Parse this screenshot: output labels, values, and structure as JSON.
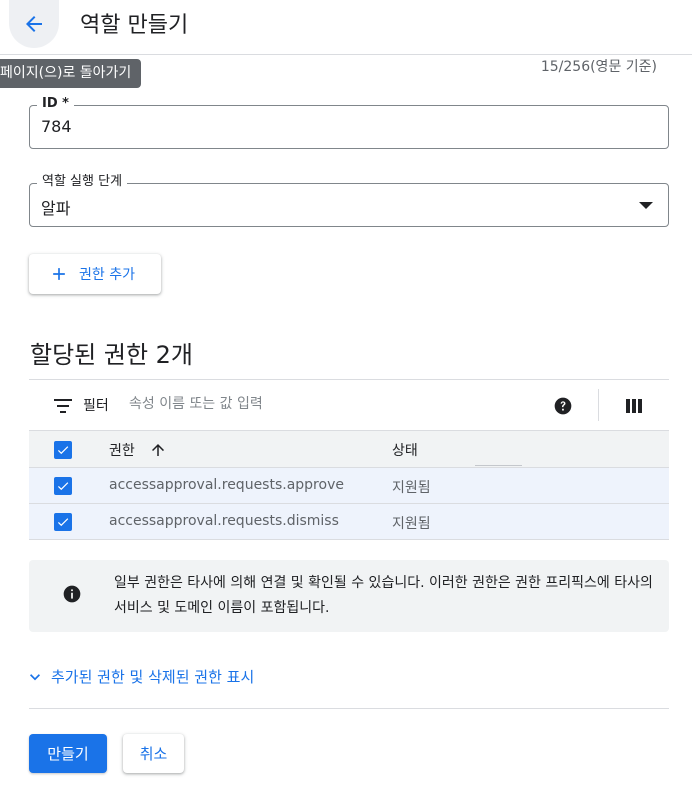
{
  "header": {
    "title": "역할 만들기",
    "back_tooltip": "페이지(으)로 돌아가기"
  },
  "form": {
    "char_count": "15/256(영문 기준)",
    "id_field": {
      "label": "ID *",
      "value": "784"
    },
    "stage_field": {
      "label": "역할 실행 단계",
      "value": "알파"
    },
    "add_permission_label": "권한 추가"
  },
  "permissions": {
    "section_title": "할당된 권한 2개",
    "filter": {
      "label": "필터",
      "placeholder": "속성 이름 또는 값 입력"
    },
    "columns": {
      "permission": "권한",
      "status": "상태"
    },
    "rows": [
      {
        "name": "accessapproval.requests.approve",
        "status": "지원됨",
        "checked": true
      },
      {
        "name": "accessapproval.requests.dismiss",
        "status": "지원됨",
        "checked": true
      }
    ]
  },
  "info": {
    "text": "일부 권한은 타사에 의해 연결 및 확인될 수 있습니다. 이러한 권한은 권한 프리픽스에 타사의 서비스 및 도메인 이름이 포함됩니다."
  },
  "expand_link": "추가된 권한 및 삭제된 권한 표시",
  "actions": {
    "create": "만들기",
    "cancel": "취소"
  },
  "colors": {
    "accent": "#1a73e8",
    "row_selected": "#eef3fc",
    "tooltip_bg": "#5f6368"
  }
}
